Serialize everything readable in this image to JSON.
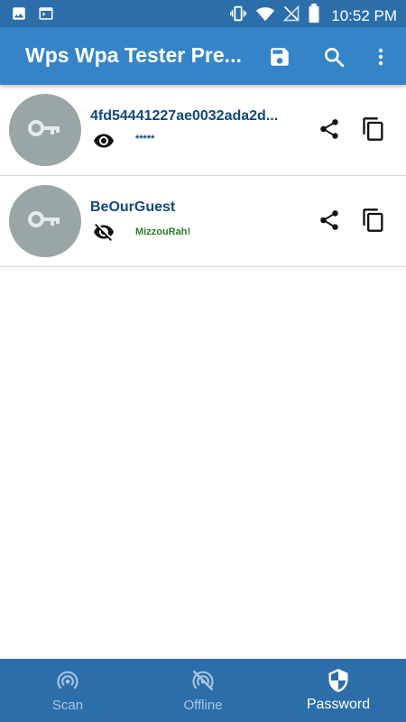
{
  "status_bar": {
    "time": "10:52 PM"
  },
  "app_bar": {
    "title": "Wps Wpa Tester Pre..."
  },
  "networks": [
    {
      "ssid": "4fd54441227ae0032ada2d...",
      "password": "*****",
      "password_visible": false
    },
    {
      "ssid": "BeOurGuest",
      "password": "MizzouRah!",
      "password_visible": true
    }
  ],
  "bottom_nav": {
    "items": [
      {
        "label": "Scan",
        "icon": "wifi-tethering-icon",
        "active": false
      },
      {
        "label": "Offline",
        "icon": "wifi-tethering-off-icon",
        "active": false
      },
      {
        "label": "Password",
        "icon": "shield-icon",
        "active": true
      }
    ]
  },
  "colors": {
    "status_bar": "#2c6ea9",
    "app_bar": "#3584c7",
    "bottom_nav": "#2c6ea9",
    "ssid_text": "#13477c",
    "password_shown": "#2c7a2c",
    "avatar": "#9aa5a6"
  }
}
